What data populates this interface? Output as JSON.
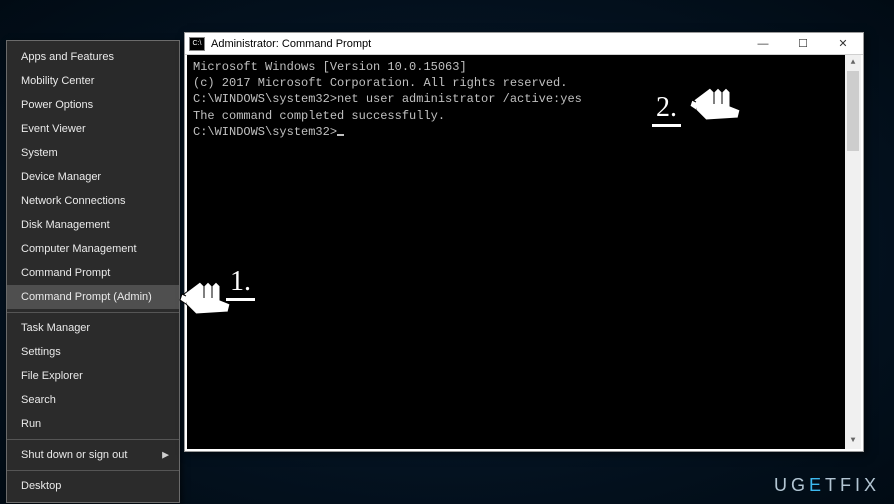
{
  "watermark": {
    "pre": "UG",
    "mid": "E",
    "post": "TFIX"
  },
  "winx": {
    "groups": [
      {
        "items": [
          "Apps and Features",
          "Mobility Center",
          "Power Options",
          "Event Viewer",
          "System",
          "Device Manager",
          "Network Connections",
          "Disk Management",
          "Computer Management",
          "Command Prompt",
          "Command Prompt (Admin)"
        ],
        "highlight_index": 10
      },
      {
        "items": [
          "Task Manager",
          "Settings",
          "File Explorer",
          "Search",
          "Run"
        ]
      },
      {
        "items_with_submenu": [
          {
            "label": "Shut down or sign out",
            "submenu": true
          }
        ],
        "items": [
          "Desktop"
        ]
      }
    ]
  },
  "cmd": {
    "title": "Administrator: Command Prompt",
    "icon_label": "C:\\",
    "controls": {
      "min": "—",
      "max": "☐",
      "close": "✕"
    },
    "lines": [
      "Microsoft Windows [Version 10.0.15063]",
      "(c) 2017 Microsoft Corporation. All rights reserved.",
      "",
      "C:\\WINDOWS\\system32>net user administrator /active:yes",
      "The command completed successfully.",
      "",
      "",
      "C:\\WINDOWS\\system32>"
    ]
  },
  "annotations": {
    "one": "1.",
    "two": "2."
  }
}
